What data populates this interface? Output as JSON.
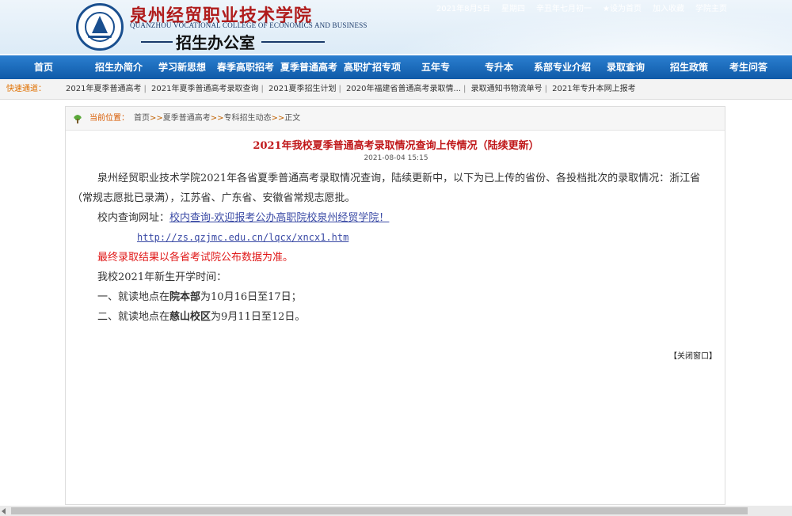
{
  "topbar": {
    "date": "2021年8月5日",
    "weekday": "星期四",
    "lunar": "辛丑年七月初一",
    "set_home": "设为首页",
    "add_fav": "加入收藏",
    "school_home": "学院主页"
  },
  "header": {
    "school_cn": "泉州经贸职业技术学院",
    "school_en": "QUANZHOU VOCATIONAL COLLEGE OF ECONOMICS AND BUSINESS",
    "office": "招生办公室"
  },
  "nav": {
    "items": [
      "首页",
      "招生办简介",
      "学习新思想",
      "春季高职招考",
      "夏季普通高考",
      "高职扩招专项",
      "五年专",
      "专升本",
      "系部专业介绍",
      "录取查询",
      "招生政策",
      "考生问答"
    ]
  },
  "quick": {
    "label": "快速通道：",
    "links": [
      "2021年夏季普通高考",
      "2021年夏季普通高考录取查询",
      "2021夏季招生计划",
      "2020年福建省普通高考录取情...",
      "录取通知书物流单号",
      "2021年专升本网上报考"
    ]
  },
  "breadcrumb": {
    "label": "当前位置：",
    "items": [
      "首页",
      "夏季普通高考",
      "专科招生动态",
      "正文"
    ]
  },
  "article": {
    "title": "2021年我校夏季普通高考录取情况查询上传情况（陆续更新）",
    "date": "2021-08-04 15:15",
    "para1": "泉州经贸职业技术学院2021年各省夏季普通高考录取情况查询，陆续更新中，以下为已上传的省份、各投档批次的录取情况：浙江省（常规志愿批已录满），江苏省、广东省、安徽省常规志愿批。",
    "query_label": "校内查询网址：",
    "query_link": "校内查询-欢迎报考公办高职院校泉州经贸学院！",
    "query_url": "http://zs.qzjmc.edu.cn/lqcx/xncx1.htm",
    "notice": "最终录取结果以各省考试院公布数据为准。",
    "open_title": "我校2021年新生开学时间：",
    "item1_pre": "一、就读地点在",
    "item1_bold": "院本部",
    "item1_post": "为10月16日至17日；",
    "item2_pre": "二、就读地点在",
    "item2_bold": "慈山校区",
    "item2_post": "为9月11日至12日。",
    "close": "【关闭窗口】"
  },
  "colors": {
    "nav_blue": "#1565b8",
    "title_red": "#c0181a",
    "notice_red": "#e01818",
    "link_blue": "#3a4aa5"
  }
}
